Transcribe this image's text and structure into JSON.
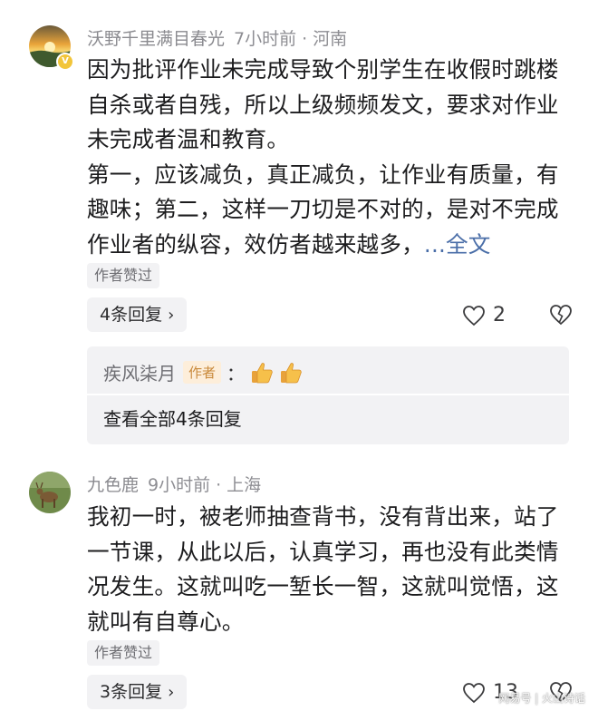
{
  "comments": [
    {
      "user": "沃野千里满目春光",
      "time": "7小时前",
      "location": "河南",
      "verified_badge": "V",
      "paragraphs": [
        "因为批评作业未完成导致个别学生在收假时跳楼自杀或者自残，所以上级频频发文，要求对作业未完成者温和教育。",
        "第一，应该减负，真正减负，让作业有质量，有趣味；第二，这样一刀切是不对的，是对不完成作业者的纵容，效仿者越来越多，"
      ],
      "more_link": "...全文",
      "author_liked": "作者赞过",
      "reply_count_label": "4条回复",
      "likes": "2",
      "reply_preview": {
        "user": "疾风柒月",
        "author_tag": "作者",
        "colon": "：",
        "emoji": [
          "thumbs-up-emoji",
          "thumbs-up-emoji"
        ],
        "see_all": "查看全部4条回复"
      }
    },
    {
      "user": "九色鹿",
      "time": "9小时前",
      "location": "上海",
      "paragraphs": [
        "我初一时，被老师抽查背书，没有背出来，站了一节课，从此以后，认真学习，再也没有此类情况发生。这就叫吃一堑长一智，这就叫觉悟，这就叫有自尊心。"
      ],
      "author_liked": "作者赞过",
      "reply_count_label": "3条回复",
      "likes": "13"
    }
  ],
  "icons": {
    "like": "heart-outline-icon",
    "dislike": "broken-heart-icon",
    "chevron": "chevron-right-icon"
  },
  "colors": {
    "link": "#4a6ea8",
    "meta": "#8e8e93",
    "pill_bg": "#f2f2f4",
    "author_tag_bg": "#fdeeda",
    "author_tag_text": "#c98a3c"
  },
  "watermark": "网易号 | 火山诗话"
}
